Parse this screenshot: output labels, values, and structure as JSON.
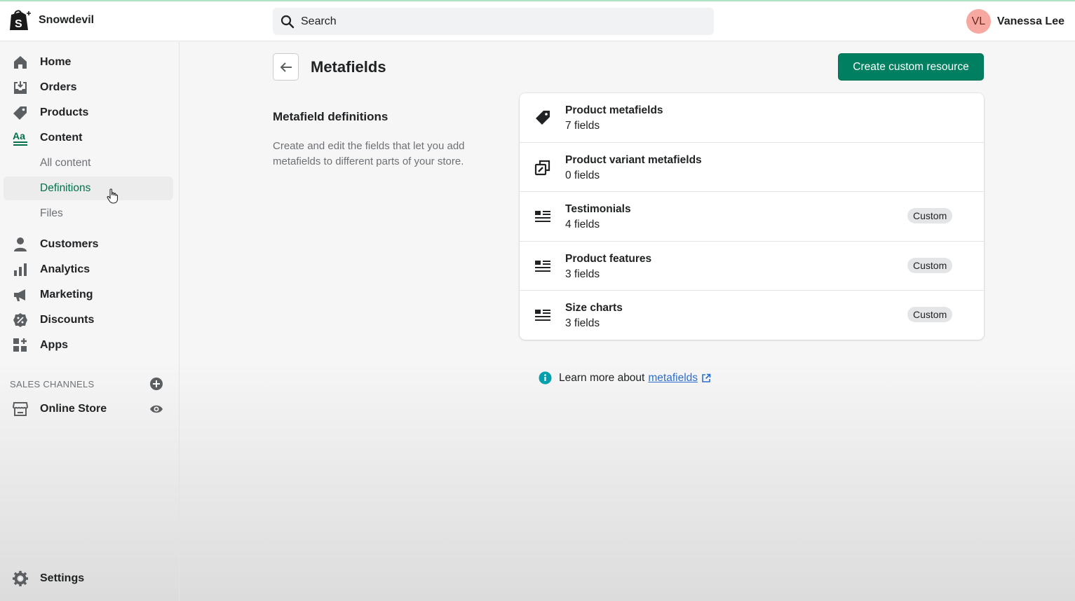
{
  "store": {
    "name": "Snowdevil"
  },
  "search": {
    "placeholder": "Search"
  },
  "user": {
    "initials": "VL",
    "name": "Vanessa Lee"
  },
  "sidebar": {
    "items": [
      {
        "label": "Home",
        "icon": "home-icon"
      },
      {
        "label": "Orders",
        "icon": "orders-icon"
      },
      {
        "label": "Products",
        "icon": "tag-icon"
      },
      {
        "label": "Content",
        "icon": "content-icon"
      },
      {
        "label": "Customers",
        "icon": "person-icon"
      },
      {
        "label": "Analytics",
        "icon": "bar-chart-icon"
      },
      {
        "label": "Marketing",
        "icon": "megaphone-icon"
      },
      {
        "label": "Discounts",
        "icon": "discount-icon"
      },
      {
        "label": "Apps",
        "icon": "apps-icon"
      }
    ],
    "content_sub": [
      {
        "label": "All content"
      },
      {
        "label": "Definitions",
        "active": true
      },
      {
        "label": "Files"
      }
    ],
    "sales_channels_title": "SALES CHANNELS",
    "online_store": "Online Store",
    "settings": "Settings"
  },
  "page": {
    "title": "Metafields",
    "primary_action": "Create custom resource",
    "section_heading": "Metafield definitions",
    "section_description": "Create and edit the fields that let you add metafields to different parts of your store."
  },
  "resources": [
    {
      "title": "Product metafields",
      "count": "7 fields",
      "badge": "",
      "icon": "tag-icon"
    },
    {
      "title": "Product variant metafields",
      "count": "0 fields",
      "badge": "",
      "icon": "variants-icon"
    },
    {
      "title": "Testimonials",
      "count": "4 fields",
      "badge": "Custom",
      "icon": "list-icon"
    },
    {
      "title": "Product features",
      "count": "3 fields",
      "badge": "Custom",
      "icon": "list-icon"
    },
    {
      "title": "Size charts",
      "count": "3 fields",
      "badge": "Custom",
      "icon": "list-icon"
    }
  ],
  "learn_more": {
    "text": "Learn more about",
    "link": "metafields"
  },
  "colors": {
    "primary": "#008060",
    "active_nav": "#00704a",
    "link": "#2c6ecb",
    "info": "#00a0ac"
  }
}
